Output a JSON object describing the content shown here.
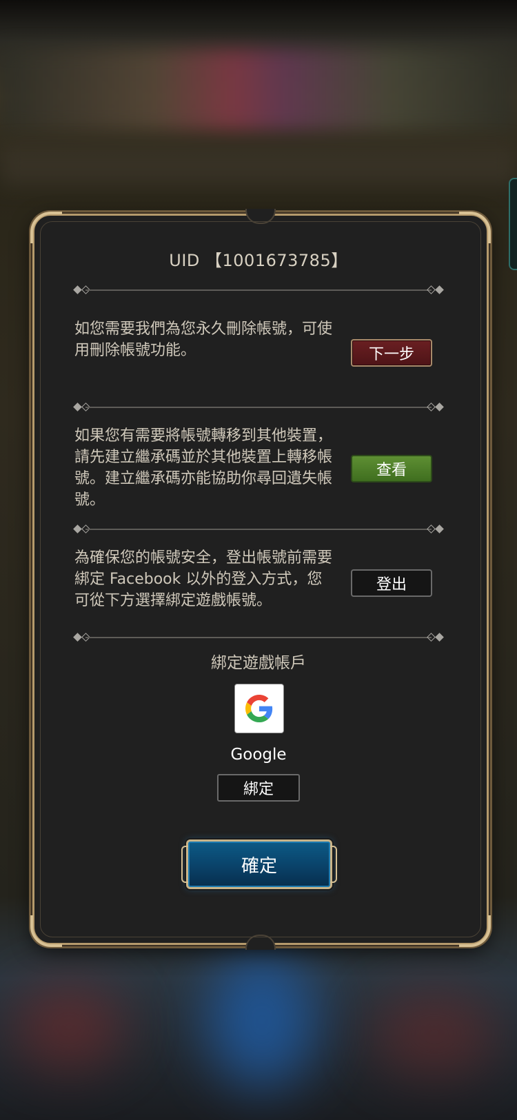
{
  "dialog": {
    "uid_text": "UID 【1001673785】",
    "sections": [
      {
        "text": "如您需要我們為您永久刪除帳號，可使用刪除帳號功能。",
        "button": "下一步"
      },
      {
        "text": "如果您有需要將帳號轉移到其他裝置，請先建立繼承碼並於其他裝置上轉移帳號。建立繼承碼亦能協助你尋回遺失帳號。",
        "button": "查看"
      },
      {
        "text": "為確保您的帳號安全，登出帳號前需要綁定 Facebook 以外的登入方式，您可從下方選擇綁定遊戲帳號。",
        "button": "登出"
      }
    ],
    "bind": {
      "title": "綁定遊戲帳戶",
      "provider_icon": "google-icon",
      "provider_name": "Google",
      "bind_button": "綁定"
    },
    "confirm_button": "確定"
  },
  "colors": {
    "delete_button": "#5a191c",
    "view_button": "#4e7f2a",
    "confirm_button": "#0a4a74",
    "frame_gold": "#d8c194",
    "panel_bg": "#202020"
  }
}
